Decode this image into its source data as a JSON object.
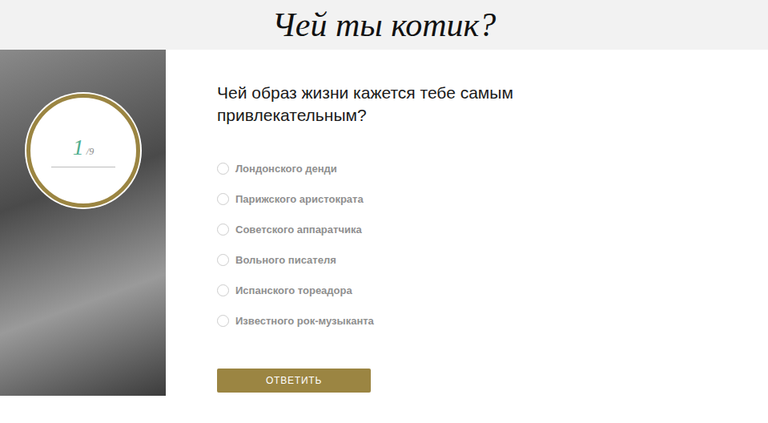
{
  "header": {
    "title": "Чей ты котик?"
  },
  "progress": {
    "current": "1",
    "total": "/9"
  },
  "question": {
    "text": "Чей образ жизни кажется тебе самым привлекательным?"
  },
  "options": [
    {
      "label": "Лондонского денди",
      "selected": false
    },
    {
      "label": "Парижского аристократа",
      "selected": false
    },
    {
      "label": "Советского аппаратчика",
      "selected": false
    },
    {
      "label": "Вольного писателя",
      "selected": false
    },
    {
      "label": "Испанского тореадора",
      "selected": false
    },
    {
      "label": "Известного рок-музыканта",
      "selected": false
    }
  ],
  "button": {
    "label": "ОТВЕТИТЬ"
  }
}
